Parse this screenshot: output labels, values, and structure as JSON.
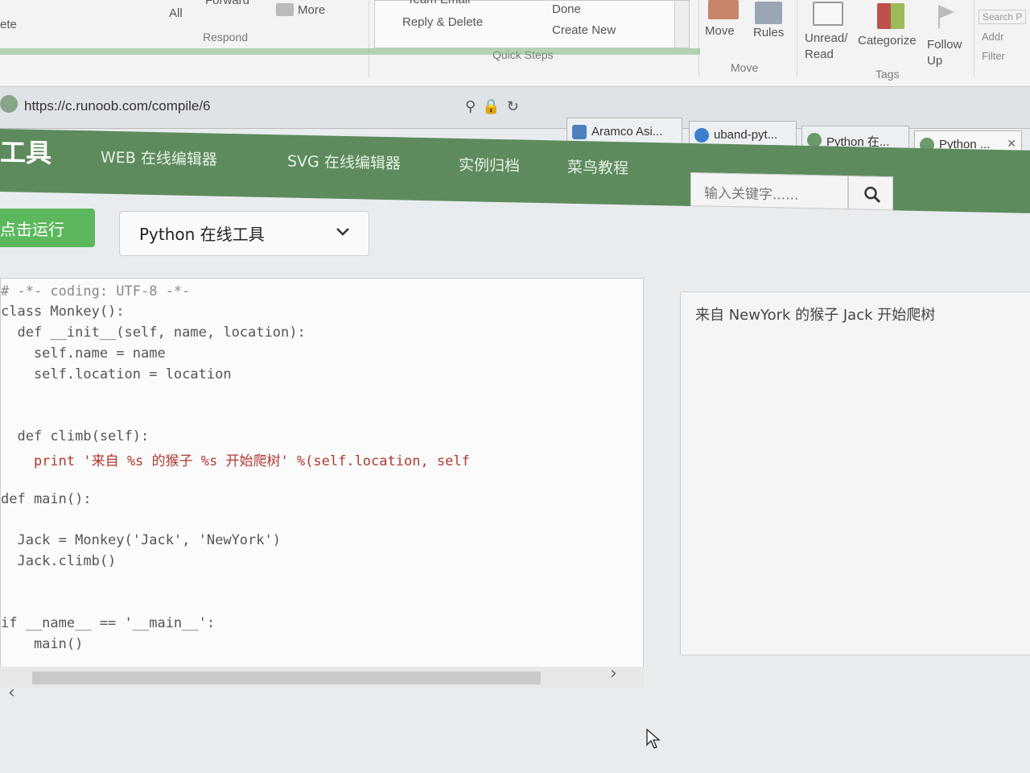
{
  "ribbon": {
    "partial_left": "ete",
    "reply_all": "All",
    "forward": "Forward",
    "more": "More",
    "respond_group": "Respond",
    "team_email": "Team Email",
    "reply_delete": "Reply & Delete",
    "done": "Done",
    "create_new": "Create New",
    "quick_steps_group": "Quick Steps",
    "move": "Move",
    "rules": "Rules",
    "move_group": "Move",
    "unread_read": "Unread/ Read",
    "categorize": "Categorize",
    "follow_up": "Follow Up",
    "tags_group": "Tags",
    "search": "Search P",
    "address": "Addr",
    "filter": "Filter"
  },
  "browser": {
    "url": "https://c.runoob.com/compile/6",
    "tabs": [
      {
        "label": "Aramco Asi..."
      },
      {
        "label": "uband-pyt..."
      },
      {
        "label": "Python 在..."
      },
      {
        "label": "Python ..."
      }
    ]
  },
  "nav": {
    "logo": "工具",
    "links": [
      "WEB 在线编辑器",
      "SVG 在线编辑器",
      "实例归档",
      "菜鸟教程"
    ],
    "search_placeholder": "输入关键字......"
  },
  "toolbar": {
    "run_label": "点击运行",
    "language": "Python 在线工具"
  },
  "editor": {
    "lines": [
      "# -*- coding: UTF-8 -*-",
      "class Monkey():",
      "  def __init__(self, name, location):",
      "    self.name = name",
      "    self.location = location",
      "",
      "",
      "  def climb(self):",
      "    print '来自 %s 的猴子 %s 开始爬树' %(self.location, self",
      "",
      "def main():",
      "",
      "  Jack = Monkey('Jack', 'NewYork')",
      "  Jack.climb()",
      "",
      "",
      "if __name__ == '__main__':",
      "    main()"
    ]
  },
  "output": {
    "text": "来自 NewYork 的猴子 Jack 开始爬树"
  },
  "colors": {
    "nav_green": "#5d8b5d",
    "run_green": "#5cb85c"
  }
}
